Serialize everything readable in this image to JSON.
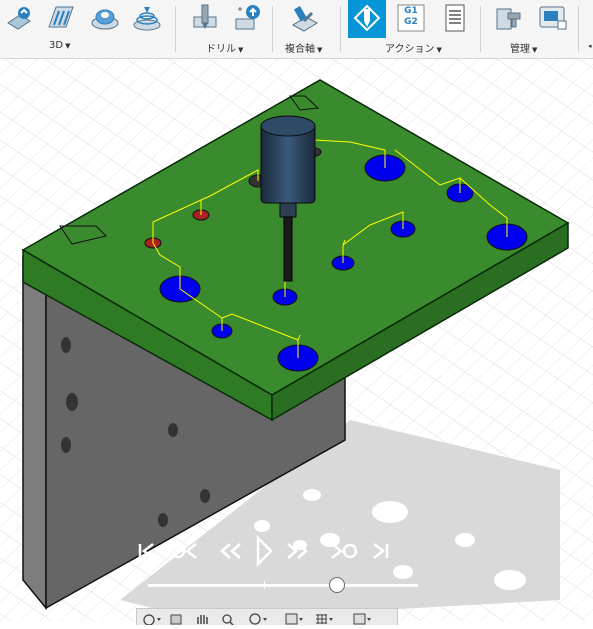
{
  "toolbar": {
    "groups": [
      {
        "label": "3D"
      },
      {
        "label": "ドリル"
      },
      {
        "label": "複合軸"
      },
      {
        "label": "アクション"
      },
      {
        "label": "管理"
      }
    ],
    "actions": {
      "g1g2_top": "G1",
      "g1g2_bottom": "G2"
    },
    "accent": "#0696d7"
  },
  "viewport": {
    "plate_color": "#3a8a2e",
    "bracket_color": "#6a6a6a",
    "hole_fill": "#0000ee",
    "toolpath_color": "#ffff00"
  },
  "playback": {
    "progress": 0.7
  }
}
